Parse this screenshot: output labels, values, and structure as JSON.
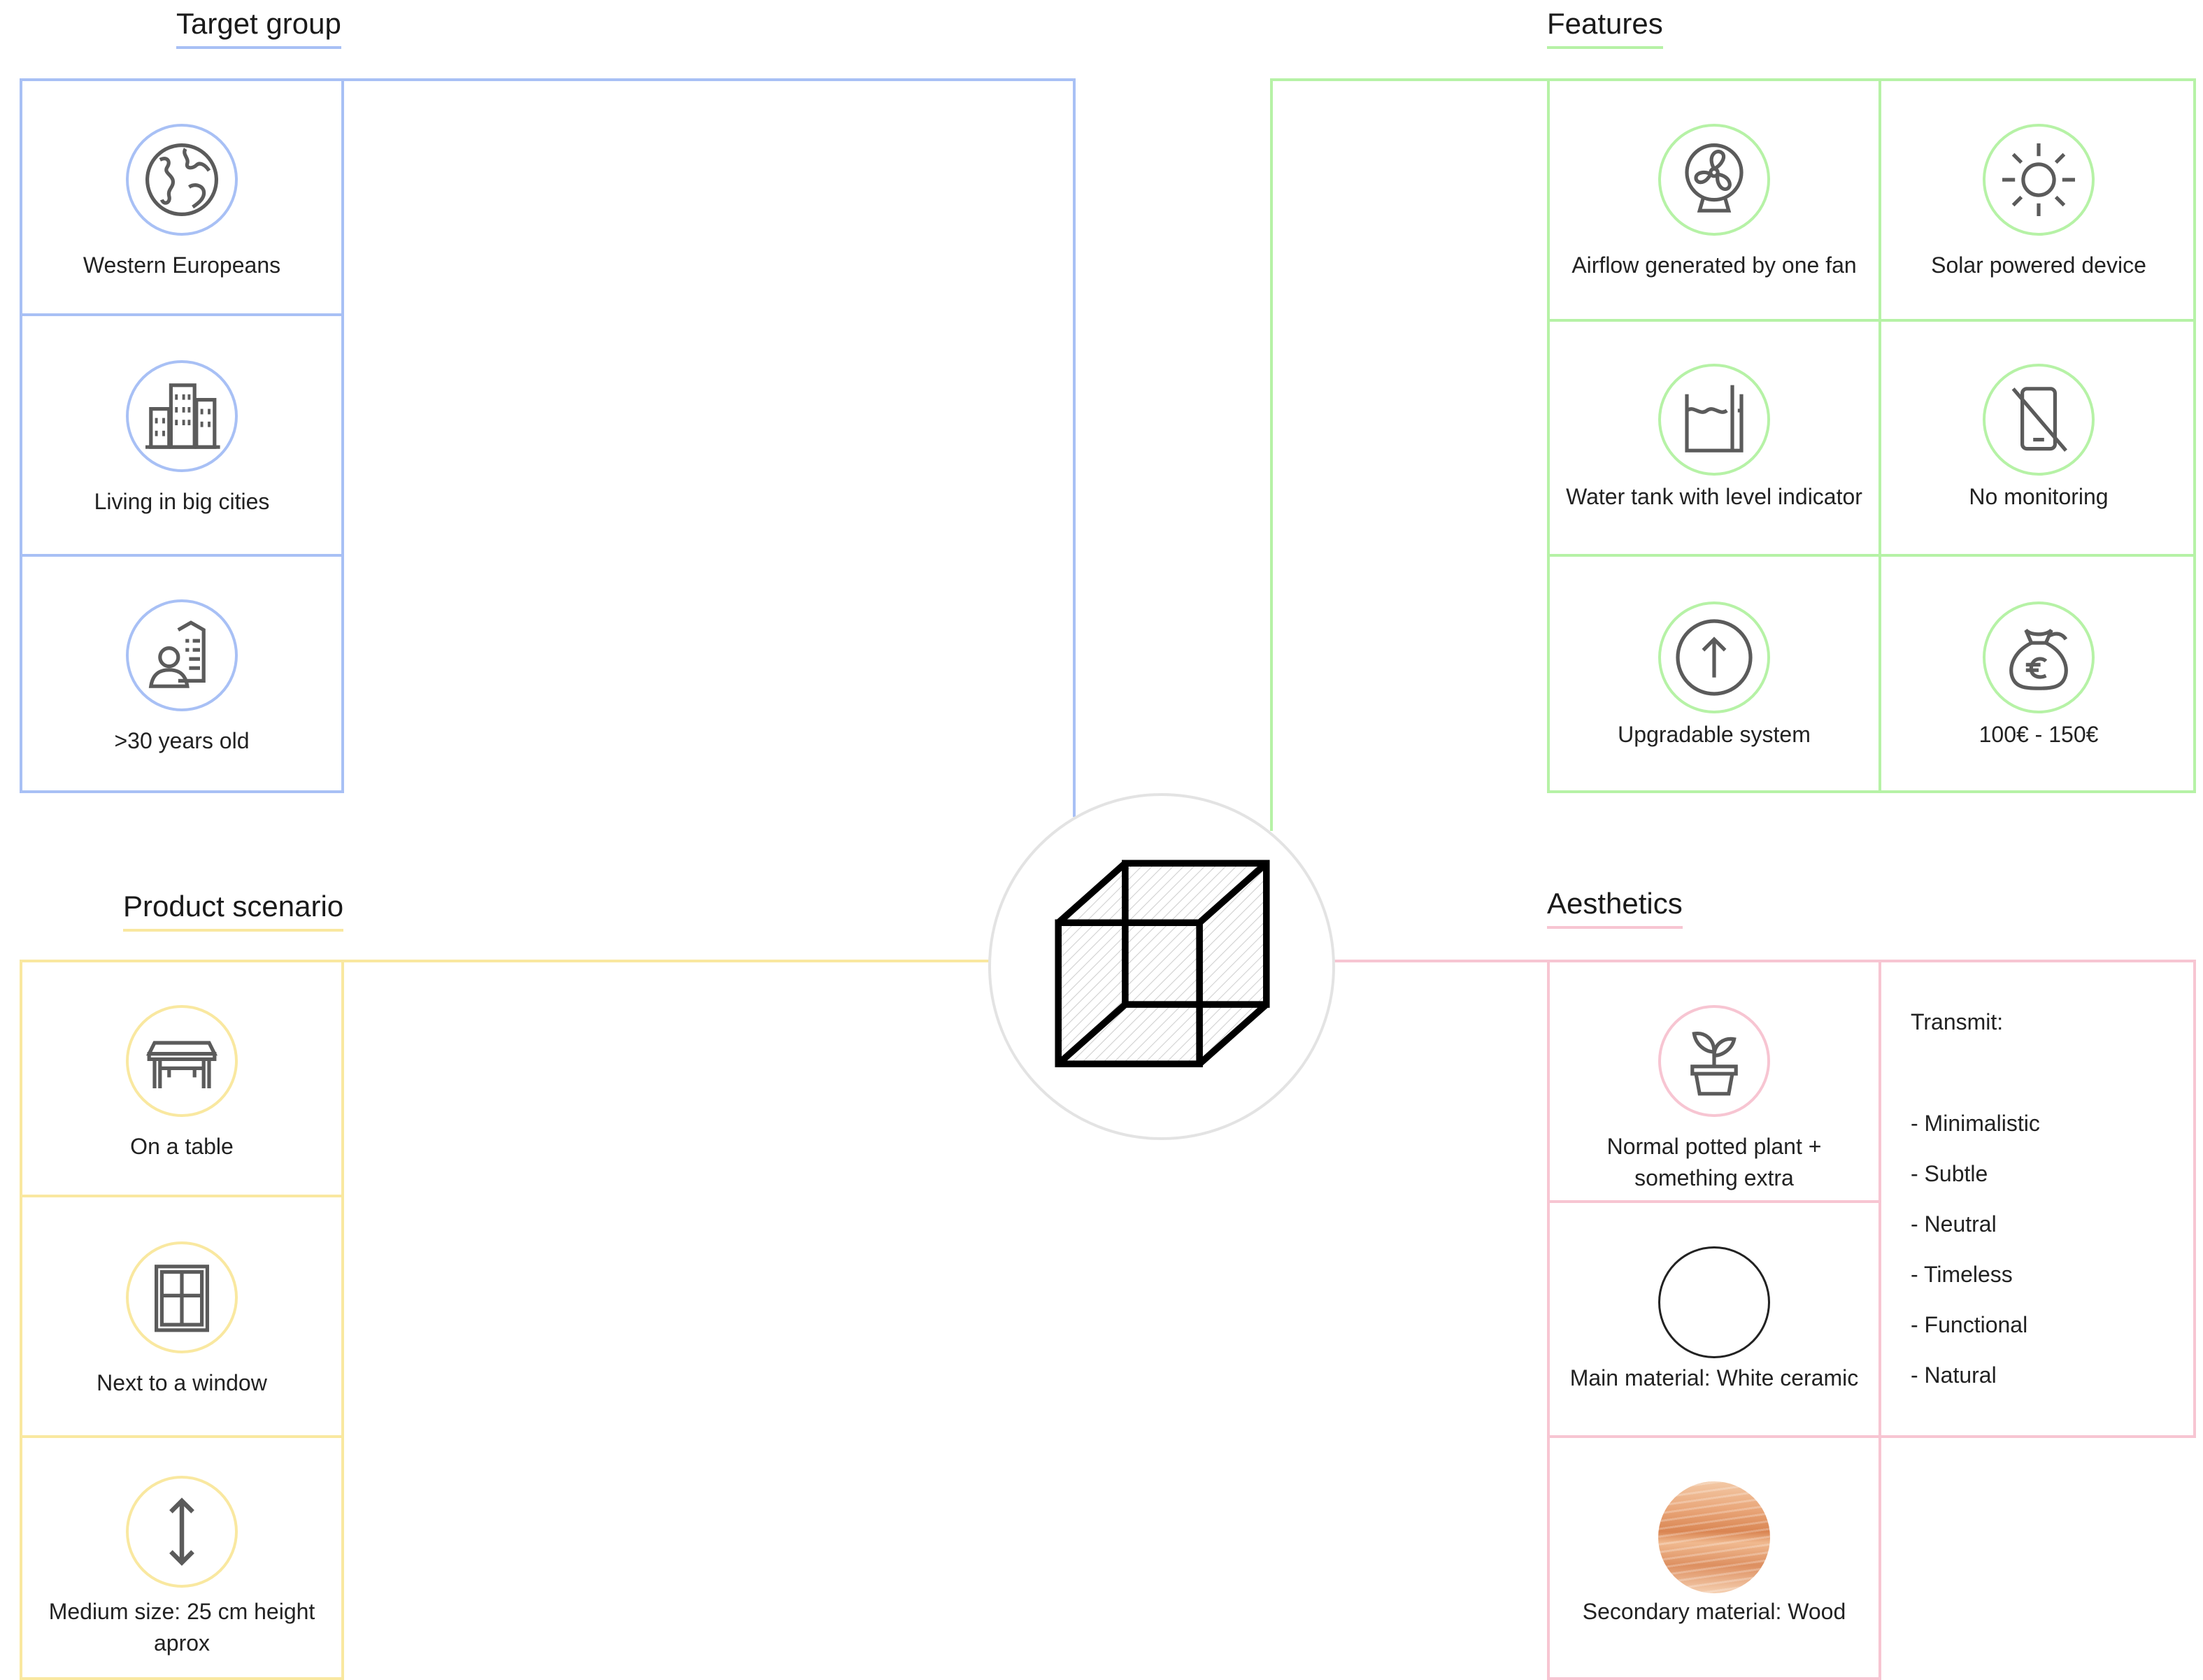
{
  "target_group": {
    "title": "Target group",
    "items": [
      {
        "label": "Western Europeans",
        "icon": "globe-icon"
      },
      {
        "label": "Living in big cities",
        "icon": "city-buildings-icon"
      },
      {
        "label": ">30 years old",
        "icon": "adult-person-icon"
      }
    ]
  },
  "features": {
    "title": "Features",
    "items": [
      {
        "label": "Airflow generated by one fan",
        "icon": "fan-icon"
      },
      {
        "label": "Solar powered device",
        "icon": "sun-icon"
      },
      {
        "label": "Water tank with level indicator",
        "icon": "water-tank-icon"
      },
      {
        "label": "No monitoring",
        "icon": "no-phone-icon"
      },
      {
        "label": "Upgradable system",
        "icon": "arrow-up-icon"
      },
      {
        "label": "100€ - 150€",
        "icon": "money-bag-euro-icon"
      }
    ]
  },
  "product_scenario": {
    "title": "Product scenario",
    "items": [
      {
        "label": "On a table",
        "icon": "table-icon"
      },
      {
        "label": "Next to a window",
        "icon": "window-icon"
      },
      {
        "label": "Medium size: 25 cm height aprox",
        "icon": "vertical-arrows-icon"
      }
    ]
  },
  "aesthetics": {
    "title": "Aesthetics",
    "items": [
      {
        "label": "Normal potted plant + something extra",
        "icon": "potted-plant-icon"
      },
      {
        "label": "Main material: White ceramic",
        "icon": "white-ceramic-swatch"
      },
      {
        "label": "Secondary material: Wood",
        "icon": "wood-swatch"
      }
    ],
    "transmit": {
      "heading": "Transmit:",
      "values": [
        "- Minimalistic",
        "- Subtle",
        "- Neutral",
        "- Timeless",
        "- Functional",
        "- Natural"
      ]
    }
  },
  "center": {
    "icon": "cube-icon"
  },
  "colors": {
    "target_group": "#a8c0f5",
    "features": "#b6f2a6",
    "product_scenario": "#f9e8a0",
    "aesthetics": "#f7c5d2",
    "icon_gray": "#5b5b5b"
  }
}
